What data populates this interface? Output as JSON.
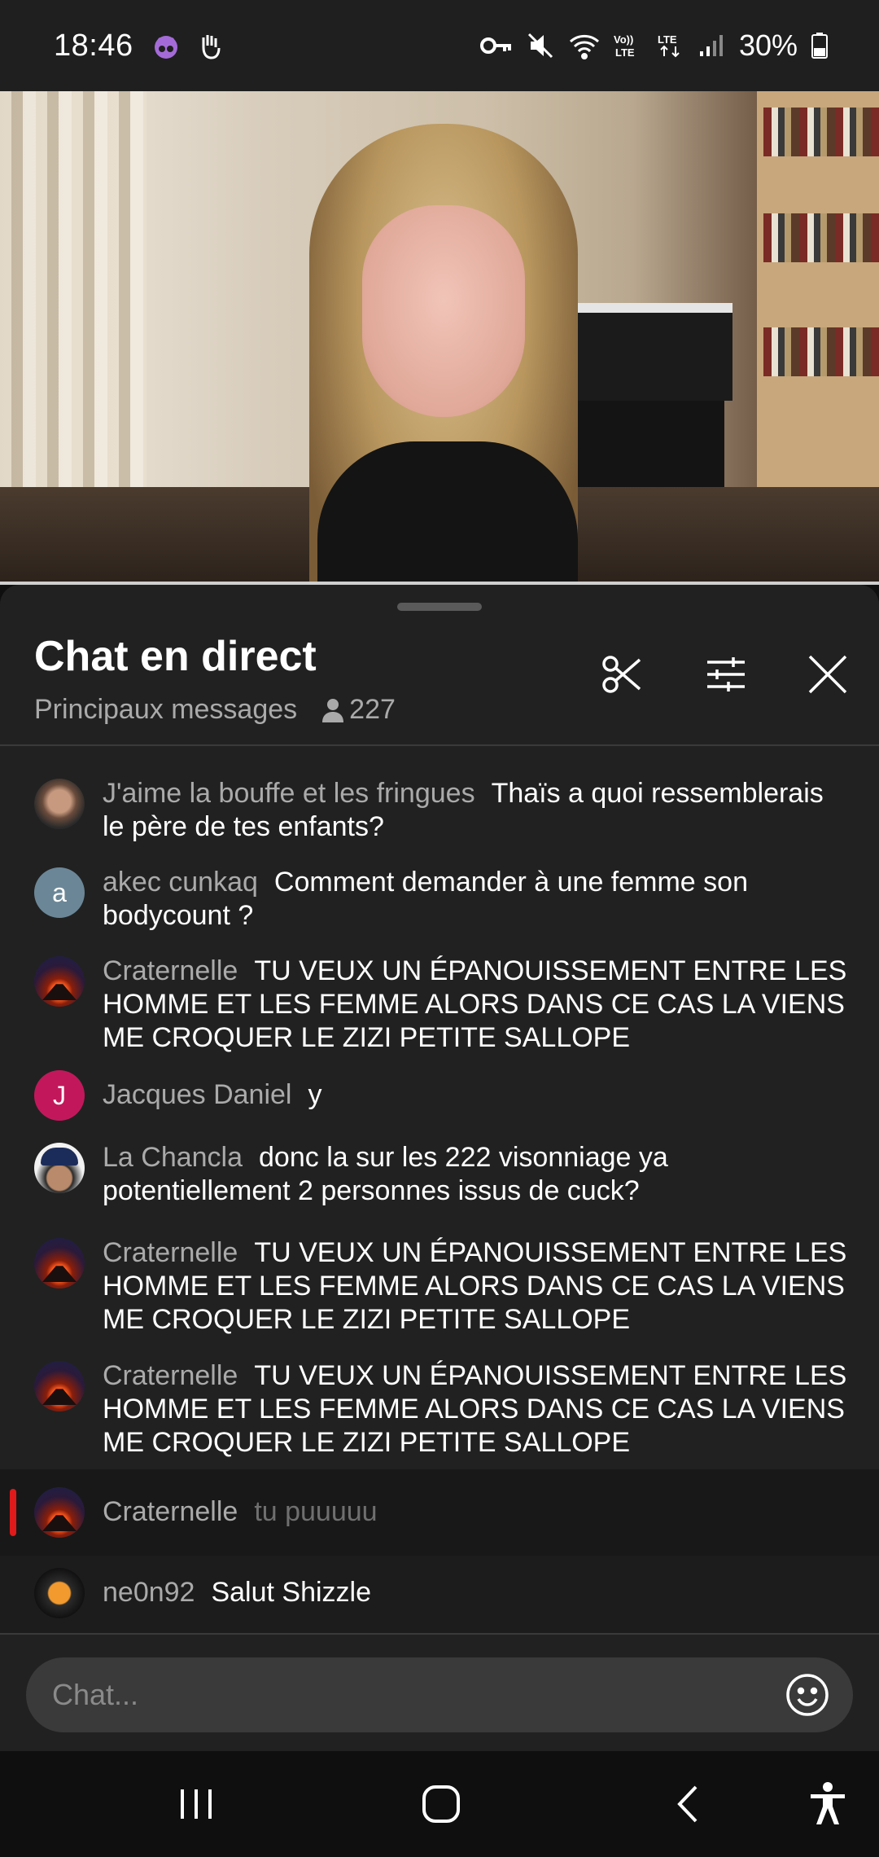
{
  "status_bar": {
    "time": "18:46",
    "network": "LTE",
    "battery": "30%",
    "icons": [
      "incognito-icon",
      "hand-icon",
      "vpn-key-icon",
      "mute-icon",
      "wifi-icon",
      "volte-icon",
      "lte-icon",
      "signal-icon",
      "battery-icon"
    ]
  },
  "chat": {
    "title": "Chat en direct",
    "mode": "Principaux messages",
    "viewers": "227",
    "messages": [
      {
        "author": "J'aime la bouffe et les fringues",
        "text": "Thaïs a quoi ressemblerais le père de tes enfants?"
      },
      {
        "author": "akec cunkaq",
        "avatar_letter": "a",
        "avatar_color": "#6b8797",
        "text": "Comment demander à une femme son bodycount ?"
      },
      {
        "author": "Craternelle",
        "text": "TU VEUX UN ÉPANOUISSEMENT ENTRE LES HOMME ET LES FEMME ALORS DANS CE CAS LA VIENS ME CROQUER LE ZIZI PETITE SALLOPE"
      },
      {
        "author": "Jacques Daniel",
        "avatar_letter": "J",
        "avatar_color": "#c2185b",
        "text": "y"
      },
      {
        "author": "La Chancla",
        "text": "donc la sur les 222 visonniage ya potentiellement 2 personnes issus de cuck?"
      },
      {
        "author": "Craternelle",
        "text": "TU VEUX UN ÉPANOUISSEMENT ENTRE LES HOMME ET LES FEMME ALORS DANS CE CAS LA VIENS ME CROQUER LE ZIZI PETITE SALLOPE"
      },
      {
        "author": "Craternelle",
        "text": "TU VEUX UN ÉPANOUISSEMENT ENTRE LES HOMME ET LES FEMME ALORS DANS CE CAS LA VIENS ME CROQUER LE ZIZI PETITE SALLOPE"
      },
      {
        "author": "Craternelle",
        "text": "tu puuuuu"
      },
      {
        "author": "ne0n92",
        "text": "Salut Shizzle"
      }
    ],
    "input_placeholder": "Chat...",
    "colors": {
      "background": "#212121",
      "author": "#aaaaaa",
      "highlight_bar": "#e01a1a"
    }
  },
  "navigation": [
    "recent-apps-button",
    "home-button",
    "back-button",
    "accessibility-button"
  ]
}
